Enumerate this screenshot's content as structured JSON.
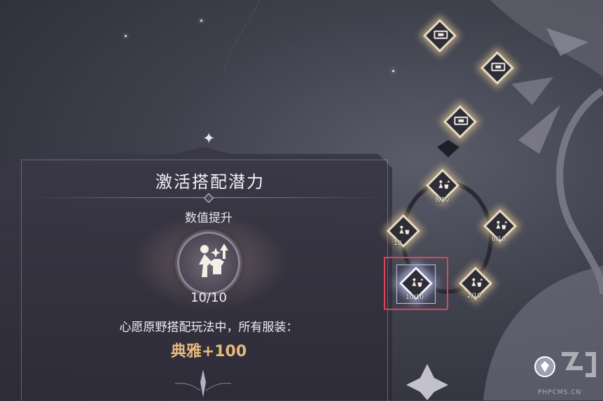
{
  "panel": {
    "title": "激活搭配潜力",
    "subtitle": "数值提升",
    "progress": "10/10",
    "description": "心愿原野搭配玩法中，所有服装：",
    "bonus": "典雅+100"
  },
  "nodes": [
    {
      "id": "node-top-1",
      "label": ""
    },
    {
      "id": "node-top-2",
      "label": ""
    },
    {
      "id": "node-top-3",
      "label": ""
    },
    {
      "id": "node-outfit-9",
      "label": "9/10"
    },
    {
      "id": "node-outfit-left",
      "label": "10"
    },
    {
      "id": "node-outfit-right",
      "label": "0/10"
    },
    {
      "id": "node-outfit-selected",
      "label": "10/10"
    },
    {
      "id": "node-outfit-2",
      "label": "2/10"
    }
  ],
  "watermark": {
    "text": "PHPCMS.CN"
  },
  "colors": {
    "accent_gold": "#e7b97a",
    "selection": "#e1445a"
  }
}
